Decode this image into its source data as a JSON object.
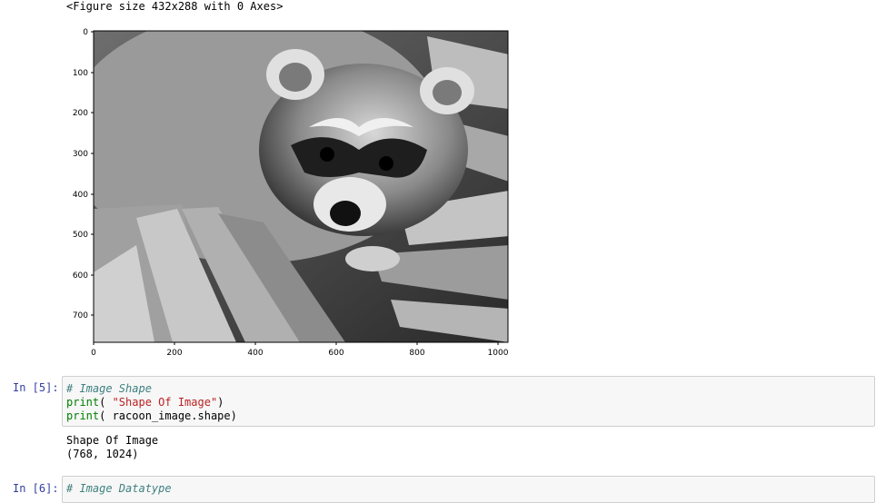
{
  "figure_output": "<Figure size 432x288 with 0 Axes>",
  "plot": {
    "image_description_icon": "raccoon-grayscale-image",
    "x_ticks": [
      "0",
      "200",
      "400",
      "600",
      "800",
      "1000"
    ],
    "y_ticks": [
      "0",
      "100",
      "200",
      "300",
      "400",
      "500",
      "600",
      "700"
    ]
  },
  "cells": [
    {
      "prompt": "In [5]:",
      "lines": [
        {
          "comment": "# Image Shape"
        },
        {
          "builtin": "print",
          "open": "( ",
          "string": "\"Shape Of Image\"",
          "close": ")"
        },
        {
          "builtin": "print",
          "open": "( ",
          "text": "racoon_image.shape",
          "close": ")"
        }
      ],
      "output": [
        "Shape Of Image",
        "(768, 1024)"
      ]
    },
    {
      "prompt": "In [6]:",
      "lines": [
        {
          "comment": "# Image Datatype"
        }
      ]
    }
  ],
  "colors": {
    "prompt": "#303f9f",
    "comment": "#408080",
    "builtin": "#008000",
    "string": "#ba2121",
    "cell_bg": "#f7f7f7",
    "cell_border": "#cfcfcf"
  }
}
